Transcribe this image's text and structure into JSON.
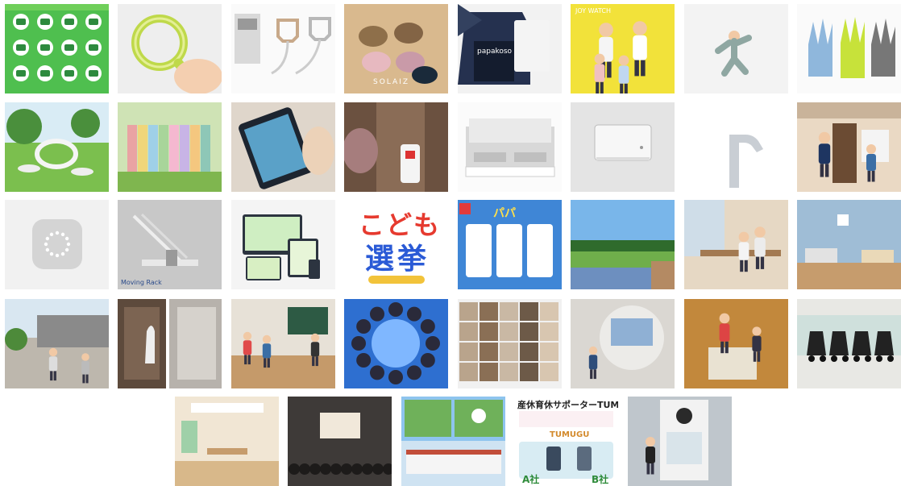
{
  "gallery": {
    "tiles": [
      {
        "kind": "infographic"
      },
      {
        "kind": "baby-teether-ring"
      },
      {
        "kind": "product-package"
      },
      {
        "kind": "sunglasses",
        "caption": "SOLAIZ"
      },
      {
        "kind": "pouch",
        "caption": "papakoso"
      },
      {
        "kind": "family-photo",
        "caption": "JOY WATCH"
      },
      {
        "kind": "kid-running"
      },
      {
        "kind": "gloves"
      },
      {
        "kind": "playground-lawn"
      },
      {
        "kind": "picture-books"
      },
      {
        "kind": "tablet-hands"
      },
      {
        "kind": "classroom-bag-hook"
      },
      {
        "kind": "ih-cooktop"
      },
      {
        "kind": "wall-heater"
      },
      {
        "kind": "faucet"
      },
      {
        "kind": "house-entrance"
      },
      {
        "kind": "smart-speaker"
      },
      {
        "kind": "moving-rack",
        "caption": "Moving Rack"
      },
      {
        "kind": "app-devices"
      },
      {
        "kind": "title-graphic",
        "line1": "こども",
        "line2": "選挙"
      },
      {
        "kind": "app-screens",
        "caption": "パパ"
      },
      {
        "kind": "landscape-field"
      },
      {
        "kind": "family-living"
      },
      {
        "kind": "blue-room"
      },
      {
        "kind": "street-kids"
      },
      {
        "kind": "storage-closet"
      },
      {
        "kind": "classroom-kids"
      },
      {
        "kind": "sky-circle-kids"
      },
      {
        "kind": "photo-collage"
      },
      {
        "kind": "kid-screen-exhibit"
      },
      {
        "kind": "kid-event-box"
      },
      {
        "kind": "stroller-rental"
      },
      {
        "kind": "nursery-room"
      },
      {
        "kind": "lecture-hall"
      },
      {
        "kind": "school-building"
      },
      {
        "kind": "tumugu-ad",
        "title": "産休育休サポーターTUMUGU",
        "brand": "TUMUGU",
        "left": "A社",
        "right": "B社"
      },
      {
        "kind": "vending-kiosk"
      }
    ]
  }
}
